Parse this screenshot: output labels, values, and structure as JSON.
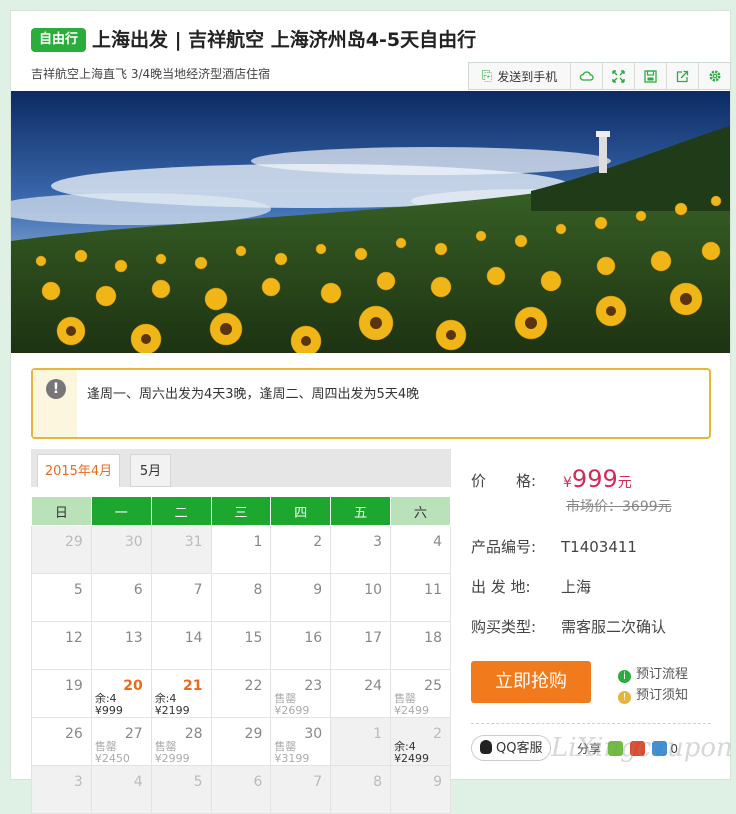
{
  "product": {
    "badge": "自由行",
    "title": "上海出发 | 吉祥航空 上海济州岛4-5天自由行",
    "subtitle": "吉祥航空上海直飞 3/4晚当地经济型酒店住宿"
  },
  "toolbar": {
    "send_label": "发送到手机",
    "icons": [
      "phone-icon",
      "cloud-icon",
      "expand-icon",
      "save-icon",
      "share-icon",
      "gear-icon"
    ]
  },
  "notice": {
    "text": "逢周一、周六出发为4天3晚，逢周二、周四出发为5天4晚"
  },
  "calendar": {
    "tabs": [
      "2015年4月",
      "5月"
    ],
    "weekdays": [
      "日",
      "一",
      "二",
      "三",
      "四",
      "五",
      "六"
    ],
    "rows": [
      [
        {
          "d": "29",
          "muted": true
        },
        {
          "d": "30",
          "muted": true
        },
        {
          "d": "31",
          "muted": true
        },
        {
          "d": "1"
        },
        {
          "d": "2"
        },
        {
          "d": "3"
        },
        {
          "d": "4"
        }
      ],
      [
        {
          "d": "5"
        },
        {
          "d": "6"
        },
        {
          "d": "7"
        },
        {
          "d": "8"
        },
        {
          "d": "9"
        },
        {
          "d": "10"
        },
        {
          "d": "11"
        }
      ],
      [
        {
          "d": "12"
        },
        {
          "d": "13"
        },
        {
          "d": "14"
        },
        {
          "d": "15"
        },
        {
          "d": "16"
        },
        {
          "d": "17"
        },
        {
          "d": "18"
        }
      ],
      [
        {
          "d": "19"
        },
        {
          "d": "20",
          "l1": "余:4",
          "l2": "¥999",
          "avail": true
        },
        {
          "d": "21",
          "l1": "余:4",
          "l2": "¥2199",
          "avail": true
        },
        {
          "d": "22"
        },
        {
          "d": "23",
          "l1": "售罄",
          "l2": "¥2699",
          "sold": true
        },
        {
          "d": "24"
        },
        {
          "d": "25",
          "l1": "售罄",
          "l2": "¥2499",
          "sold": true
        }
      ],
      [
        {
          "d": "26"
        },
        {
          "d": "27",
          "l1": "售罄",
          "l2": "¥2450",
          "sold": true
        },
        {
          "d": "28",
          "l1": "售罄",
          "l2": "¥2999",
          "sold": true
        },
        {
          "d": "29"
        },
        {
          "d": "30",
          "l1": "售罄",
          "l2": "¥3199",
          "sold": true
        },
        {
          "d": "1",
          "muted": true
        },
        {
          "d": "2",
          "l1": "余:4",
          "l2": "¥2499",
          "muted": true
        }
      ],
      [
        {
          "d": "3",
          "muted": true
        },
        {
          "d": "4",
          "muted": true
        },
        {
          "d": "5",
          "muted": true
        },
        {
          "d": "6",
          "muted": true
        },
        {
          "d": "7",
          "muted": true
        },
        {
          "d": "8",
          "muted": true
        },
        {
          "d": "9",
          "muted": true
        }
      ]
    ]
  },
  "pricing": {
    "label": "价　　格:",
    "currency": "¥",
    "price": "999",
    "unit": "元",
    "market": "市场价：3699元"
  },
  "details": [
    {
      "label": "产品编号:",
      "value": "T1403411"
    },
    {
      "label": "出 发 地:",
      "value": "上海"
    },
    {
      "label": "购买类型:",
      "value": "需客服二次确认"
    }
  ],
  "actions": {
    "buy": "立即抢购",
    "flow": "预订流程",
    "notes": "预订须知"
  },
  "social": {
    "qq": "QQ客服",
    "share": "分享",
    "count": "0"
  },
  "colors": {
    "brand_green": "#2aad3c",
    "accent_orange": "#f07a1c",
    "price_red": "#d22b57",
    "notice_border": "#e7b53c"
  },
  "watermark": "LiXingcoupon"
}
